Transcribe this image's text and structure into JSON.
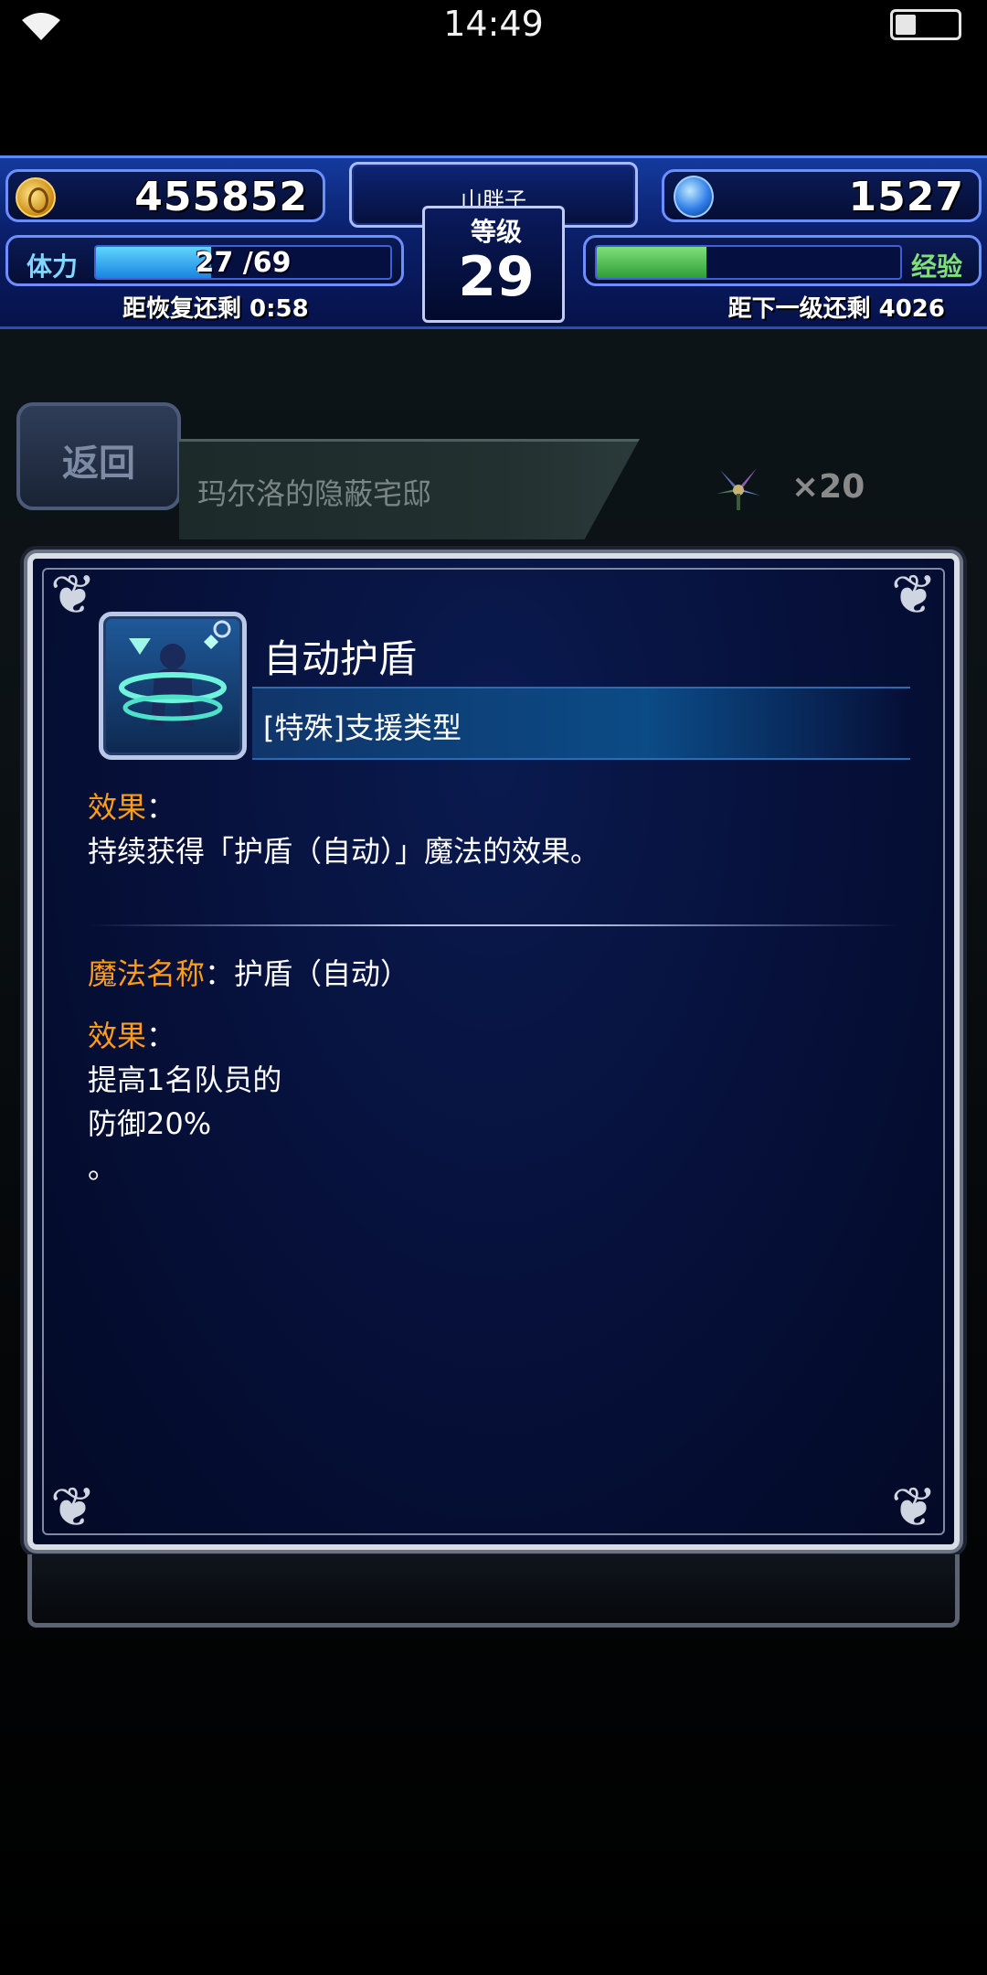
{
  "status_bar": {
    "time": "14:49"
  },
  "hud": {
    "gil": "455852",
    "gems": "1527",
    "player_name": "山胖子",
    "level_label": "等级",
    "level": "29",
    "stamina_label": "体力",
    "stamina_value": "27 /69",
    "stamina_fraction": 0.39,
    "recover_label": "距恢复还剩 0:58",
    "exp_label": "经验",
    "exp_fraction": 0.36,
    "next_level_label": "距下一级还剩 4026"
  },
  "nav": {
    "back_label": "返回",
    "location": "玛尔洛的隐蔽宅邸",
    "item_count": "×20"
  },
  "dialog": {
    "ability_name": "自动护盾",
    "ability_type": "[特殊]支援类型",
    "effect_heading": "效果",
    "effect_colon": "：",
    "effect_text": "持续获得「护盾（自动）」魔法的效果。",
    "magic_name_heading": "魔法名称",
    "magic_name_value": "：护盾（自动）",
    "effect2_heading": "效果",
    "effect2_colon": "：",
    "effect2_line1": "提高1名队员的",
    "effect2_line2": "防御20%",
    "effect2_line3": "。"
  },
  "colors": {
    "accent_orange": "#ff9d1a",
    "hud_blue": "#143a9e",
    "exp_green": "#2f9e36",
    "stamina_blue": "#1a86e0"
  },
  "icons": {
    "wifi": "wifi-icon",
    "battery": "battery-icon",
    "gil": "gil-coin-icon",
    "gem": "gem-icon",
    "ability": "auto-shield-icon",
    "item": "flower-icon"
  }
}
